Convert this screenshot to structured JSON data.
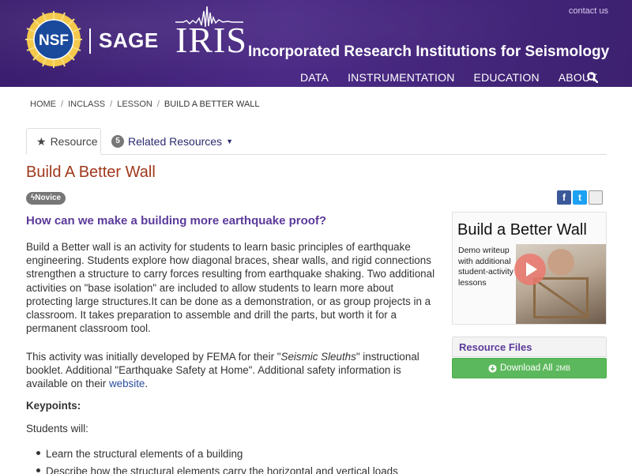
{
  "header": {
    "contact": "contact us",
    "nsf": "NSF",
    "sage": "SAGE",
    "iris": "IRIS",
    "org_name": "Incorporated Research Institutions for Seismology",
    "nav": [
      "DATA",
      "INSTRUMENTATION",
      "EDUCATION",
      "ABOUT"
    ]
  },
  "breadcrumb": [
    "HOME",
    "INCLASS",
    "LESSON",
    "BUILD A BETTER WALL"
  ],
  "tabs": {
    "resource": "Resource",
    "related_count": "5",
    "related": "Related Resources"
  },
  "title": "Build A Better Wall",
  "level": "Novice",
  "question": "How can we make a building more earthquake proof?",
  "paragraph1": "Build a Better wall is an activity for students to learn basic principles of earthquake engineering.  Students explore how diagonal braces, shear walls, and rigid connections strengthen a structure to carry forces resulting from earthquake shaking. Two additional activities on \"base isolation\" are included to allow students to learn more about protecting large structures.It can be done as a demonstration, or as group projects in a classroom. It takes preparation to assemble and drill the parts, but worth it for a permanent classroom tool.",
  "paragraph2": {
    "a": "This activity was initially developed by FEMA for their \"",
    "em": "Seismic Sleuths",
    "b": "\" instructional booklet. Additional \"Earthquake Safety at Home\". Additional safety information is available on their ",
    "link": "website",
    "c": "."
  },
  "keypoints_label": "Keypoints:",
  "students_label": "Students will:",
  "bullets": [
    "Learn the structural elements of a building",
    "Describe how the structural elements carry the horizontal and vertical loads"
  ],
  "video": {
    "title": "Build a Better Wall",
    "desc": "Demo writeup with additional student-activity lessons"
  },
  "resource_files": {
    "title": "Resource Files",
    "download": "Download All",
    "size": "2MB"
  },
  "colors": {
    "header_bg": "#4b2a86",
    "title": "#a0381c",
    "question": "#5b3a9a",
    "download": "#5cb85c"
  }
}
